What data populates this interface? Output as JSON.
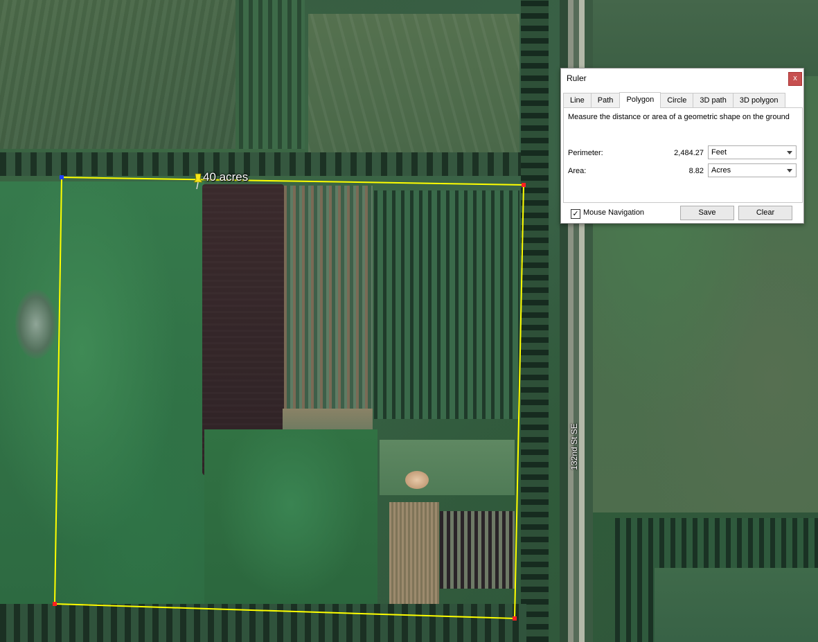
{
  "map": {
    "placemark_label": "40 acres",
    "road_label": "132nd St SE",
    "polygon_color": "#ffff00",
    "vertex_start_color": "#2040ff",
    "vertex_color": "#ff2020",
    "pin_color": "#f5e61a"
  },
  "ruler": {
    "title": "Ruler",
    "close_label": "x",
    "tabs": [
      {
        "label": "Line"
      },
      {
        "label": "Path"
      },
      {
        "label": "Polygon"
      },
      {
        "label": "Circle"
      },
      {
        "label": "3D path"
      },
      {
        "label": "3D polygon"
      }
    ],
    "active_tab": "Polygon",
    "description": "Measure the distance or area of a geometric shape on the ground",
    "perimeter": {
      "label": "Perimeter:",
      "value": "2,484.27",
      "unit": "Feet"
    },
    "area": {
      "label": "Area:",
      "value": "8.82",
      "unit": "Acres"
    },
    "mouse_navigation": {
      "label": "Mouse Navigation",
      "checked": true,
      "mark": "✓"
    },
    "save_label": "Save",
    "clear_label": "Clear"
  }
}
